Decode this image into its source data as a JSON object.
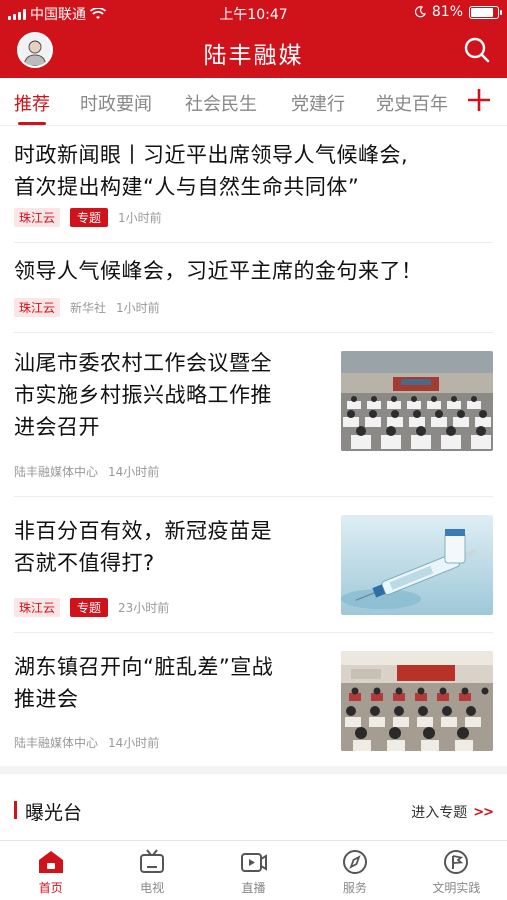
{
  "status_bar": {
    "carrier": "中国联通",
    "time": "上午10:47",
    "battery": "81%"
  },
  "header": {
    "title": "陆丰融媒"
  },
  "tabs": [
    {
      "label": "推荐",
      "active": true
    },
    {
      "label": "时政要闻",
      "active": false
    },
    {
      "label": "社会民生",
      "active": false
    },
    {
      "label": "党建行",
      "active": false
    },
    {
      "label": "党史百年",
      "active": false
    }
  ],
  "articles": [
    {
      "title_line1": "时政新闻眼丨习近平出席领导人气候峰会,",
      "title_line2": "首次提出构建“人与自然生命共同体”",
      "source": "珠江云",
      "topic_tag": "专题",
      "time": "1小时前"
    },
    {
      "title_line1": "领导人气候峰会，习近平主席的金句来了！",
      "source": "珠江云",
      "outlet": "新华社",
      "time": "1小时前"
    },
    {
      "title_line1": "汕尾市委农村工作会议暨全",
      "title_line2": "市实施乡村振兴战略工作推",
      "title_line3": "进会召开",
      "source": "陆丰融媒体中心",
      "time": "14小时前",
      "image": "meeting-hall-image"
    },
    {
      "title_line1": "非百分百有效，新冠疫苗是",
      "title_line2": "否就不值得打?",
      "source": "珠江云",
      "topic_tag": "专题",
      "time": "23小时前",
      "image": "vaccine-syringe-image"
    },
    {
      "title_line1": "湖东镇召开向“脏乱差”宣战",
      "title_line2": "推进会",
      "source": "陆丰融媒体中心",
      "time": "14小时前",
      "image": "meeting-room-image"
    }
  ],
  "section": {
    "title": "曝光台",
    "more": "进入专题",
    "arrows": ">>"
  },
  "bottom_nav": [
    {
      "label": "首页",
      "icon": "home-icon",
      "active": true
    },
    {
      "label": "电视",
      "icon": "tv-icon",
      "active": false
    },
    {
      "label": "直播",
      "icon": "live-icon",
      "active": false
    },
    {
      "label": "服务",
      "icon": "compass-icon",
      "active": false
    },
    {
      "label": "文明实践",
      "icon": "flag-icon",
      "active": false
    }
  ],
  "colors": {
    "brand_red": "#d0121b"
  }
}
